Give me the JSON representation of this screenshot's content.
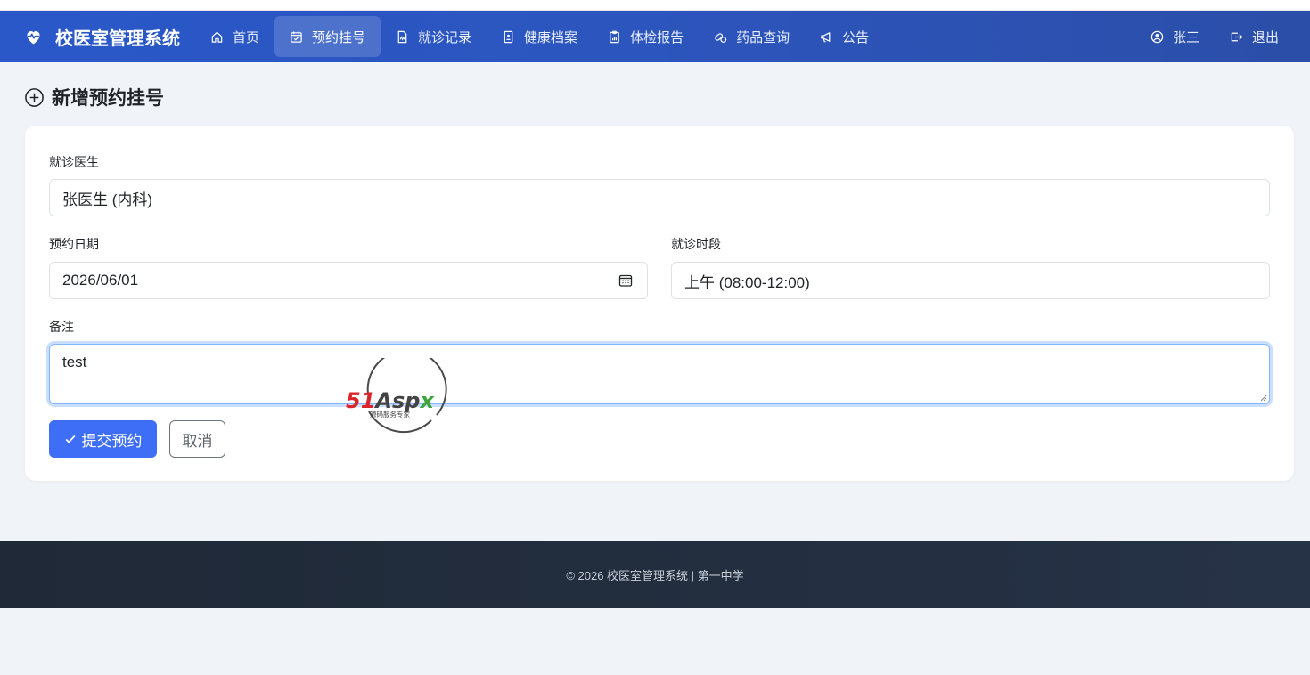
{
  "app": {
    "title": "校医室管理系统"
  },
  "nav": {
    "items": [
      {
        "label": "首页",
        "icon": "house-icon",
        "active": false
      },
      {
        "label": "预约挂号",
        "icon": "calendar-check-icon",
        "active": true
      },
      {
        "label": "就诊记录",
        "icon": "file-medical-icon",
        "active": false
      },
      {
        "label": "健康档案",
        "icon": "file-person-icon",
        "active": false
      },
      {
        "label": "体检报告",
        "icon": "clipboard-data-icon",
        "active": false
      },
      {
        "label": "药品查询",
        "icon": "capsule-icon",
        "active": false
      },
      {
        "label": "公告",
        "icon": "megaphone-icon",
        "active": false
      }
    ],
    "user": {
      "label": "张三",
      "icon": "person-circle-icon"
    },
    "logout": {
      "label": "退出",
      "icon": "box-arrow-right-icon"
    }
  },
  "page": {
    "title": "新增预约挂号",
    "title_icon": "plus-circle-icon"
  },
  "form": {
    "doctor": {
      "label": "就诊医生",
      "value": "张医生 (内科)"
    },
    "date": {
      "label": "预约日期",
      "value": "2026/06/01",
      "icon": "calendar-icon"
    },
    "slot": {
      "label": "就诊时段",
      "value": "上午 (08:00-12:00)"
    },
    "remark": {
      "label": "备注",
      "value": "test"
    },
    "submit_label": "提交预约",
    "cancel_label": "取消"
  },
  "watermark": {
    "text": "51Aspx",
    "subtext": "源码服务专家"
  },
  "footer": {
    "text": "© 2026 校医室管理系统 | 第一中学"
  },
  "colors": {
    "navbar": "#2b55c0",
    "primary": "#3d6ef5",
    "footer": "#1f2937",
    "background": "#f0f3f7"
  }
}
